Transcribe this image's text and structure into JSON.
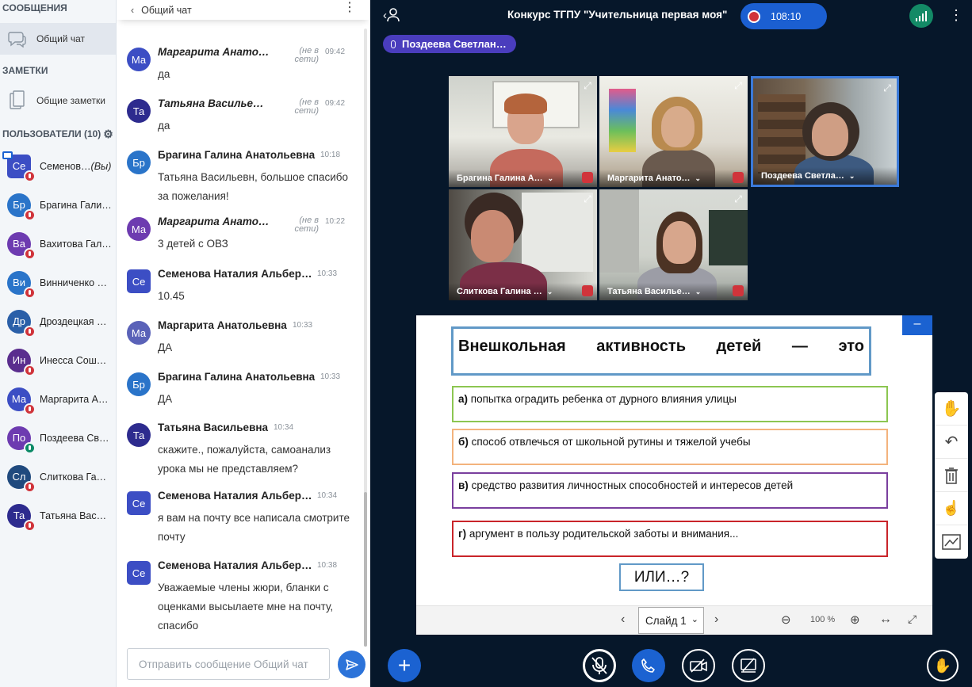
{
  "sidebar": {
    "messages_header": "СООБЩЕНИЯ",
    "public_chat": "Общий чат",
    "notes_header": "ЗАМЕТКИ",
    "shared_notes": "Общие заметки",
    "users_header": "ПОЛЬЗОВАТЕЛИ (10)",
    "users": [
      {
        "initials": "Се",
        "name": "Семенов…",
        "suffix": "(Вы)",
        "color": "#3c4ec4",
        "square": true,
        "mic": "muted"
      },
      {
        "initials": "Бр",
        "name": "Брагина Гали…",
        "suffix": "",
        "color": "#2a74c9",
        "square": false,
        "mic": "muted"
      },
      {
        "initials": "Ва",
        "name": "Вахитова Гал…",
        "suffix": "",
        "color": "#6d3bb0",
        "square": false,
        "mic": "muted"
      },
      {
        "initials": "Ви",
        "name": "Винниченко …",
        "suffix": "",
        "color": "#2a74c9",
        "square": false,
        "mic": "muted"
      },
      {
        "initials": "Др",
        "name": "Дроздецкая …",
        "suffix": "",
        "color": "#2a5fa8",
        "square": false,
        "mic": "muted"
      },
      {
        "initials": "Ин",
        "name": "Инесса Сош…",
        "suffix": "",
        "color": "#5a2d8e",
        "square": false,
        "mic": "muted"
      },
      {
        "initials": "Ма",
        "name": "Маргарита А…",
        "suffix": "",
        "color": "#3c4ec4",
        "square": false,
        "mic": "muted"
      },
      {
        "initials": "По",
        "name": "Поздеева Св…",
        "suffix": "",
        "color": "#6d3bb0",
        "square": false,
        "mic": "on"
      },
      {
        "initials": "Сл",
        "name": "Слиткова Га…",
        "suffix": "",
        "color": "#204a7e",
        "square": false,
        "mic": "muted"
      },
      {
        "initials": "Та",
        "name": "Татьяна Вас…",
        "suffix": "",
        "color": "#2d2b8e",
        "square": false,
        "mic": "muted"
      }
    ]
  },
  "chat": {
    "title": "Общий чат",
    "offline_label": "(не в сети)",
    "messages": [
      {
        "initials": "Ма",
        "color": "#3c4ec4",
        "name": "Маргарита Анато…",
        "italic": true,
        "offline": true,
        "time": "09:42",
        "text": "да"
      },
      {
        "initials": "Та",
        "color": "#2d2b8e",
        "name": "Татьяна Василье…",
        "italic": true,
        "offline": true,
        "time": "09:42",
        "text": "да"
      },
      {
        "initials": "Бр",
        "color": "#2a74c9",
        "name": "Брагина Галина Анатольевна",
        "italic": false,
        "offline": false,
        "time": "10:18",
        "text": "Татьяна Васильевн, большое спасибо за пожелания!"
      },
      {
        "initials": "Ма",
        "color": "#6d3bb0",
        "name": "Маргарита Анато…",
        "italic": true,
        "offline": true,
        "time": "10:22",
        "text": "3 детей с ОВЗ"
      },
      {
        "initials": "Се",
        "color": "#3c4ec4",
        "name": "Семенова Наталия Альбер…",
        "italic": false,
        "offline": false,
        "time": "10:33",
        "text": "10.45",
        "square": true
      },
      {
        "initials": "Ма",
        "color": "#5a62b8",
        "name": "Маргарита Анатольевна",
        "italic": false,
        "offline": false,
        "time": "10:33",
        "text": "ДА"
      },
      {
        "initials": "Бр",
        "color": "#2a74c9",
        "name": "Брагина Галина Анатольевна",
        "italic": false,
        "offline": false,
        "time": "10:33",
        "text": "ДА"
      },
      {
        "initials": "Та",
        "color": "#2d2b8e",
        "name": "Татьяна Васильевна",
        "italic": false,
        "offline": false,
        "time": "10:34",
        "text": "скажите., пожалуйста, самоанализ урока мы не представляем?"
      },
      {
        "initials": "Се",
        "color": "#3c4ec4",
        "name": "Семенова Наталия Альбер…",
        "italic": false,
        "offline": false,
        "time": "10:34",
        "text": "я вам на почту все написала смотрите почту",
        "square": true
      },
      {
        "initials": "Се",
        "color": "#3c4ec4",
        "name": "Семенова Наталия Альбер…",
        "italic": false,
        "offline": false,
        "time": "10:38",
        "text": "Уважаемые члены жюри, бланки с оценками высылаете мне на почту, спасибо",
        "square": true
      }
    ],
    "input_placeholder": "Отправить сообщение Общий чат"
  },
  "meeting": {
    "title": "Конкурс ТГПУ \"Учительница первая моя\"",
    "timer": "108:10",
    "talking": "Поздеева Светлан…"
  },
  "videos": [
    {
      "label": "Брагина Галина А…",
      "highlight": false
    },
    {
      "label": "Маргарита Анато…",
      "highlight": false
    },
    {
      "label": "Поздеева Светла…",
      "highlight": true
    },
    {
      "label": "Слиткова Галина …",
      "highlight": false
    },
    {
      "label": "Татьяна Василье…",
      "highlight": false
    }
  ],
  "slide": {
    "title_words": [
      "Внешкольная",
      "активность",
      "детей",
      "—",
      "это"
    ],
    "options": [
      {
        "letter": "а)",
        "text": "попытка оградить ребенка от дурного влияния улицы",
        "border": "#8cc651"
      },
      {
        "letter": "б)",
        "text": "способ отвлечься от школьной рутины и тяжелой учебы",
        "border": "#f3b37d"
      },
      {
        "letter": "в)",
        "text": "средство развития личностных способностей и интересов детей",
        "border": "#7a3f9e"
      },
      {
        "letter": "г)",
        "text": "аргумент в пользу родительской заботы и внимания...",
        "border": "#c9242a"
      }
    ],
    "bottom": "ИЛИ…?",
    "selector": "Слайд 1",
    "zoom": "100 %"
  }
}
